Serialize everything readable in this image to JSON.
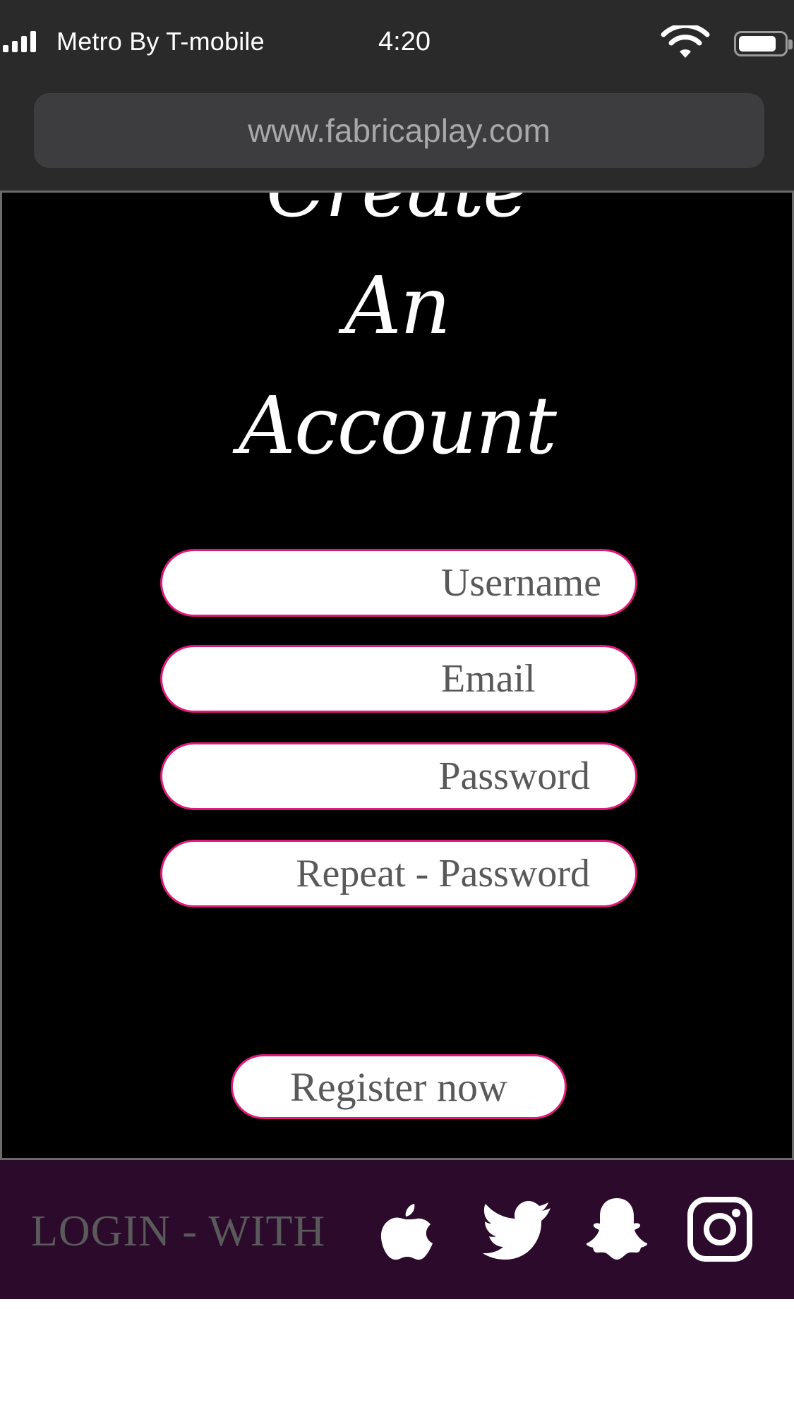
{
  "status_bar": {
    "carrier": "Metro By T-mobile",
    "time": "4:20"
  },
  "browser": {
    "url": "www.fabricaplay.com"
  },
  "page": {
    "title_lines": [
      "Create",
      "An",
      "Account"
    ],
    "fields": {
      "username_placeholder": "Username",
      "email_placeholder": "Email",
      "password_placeholder": "Password",
      "repeat_password_placeholder": "Repeat - Password"
    },
    "register_label": "Register now",
    "login_with_label": "LOGIN  - WITH",
    "social_icons": [
      "apple-icon",
      "twitter-icon",
      "snapchat-icon",
      "instagram-icon"
    ],
    "colors": {
      "accent": "#e01a7a",
      "footer_bg": "#2b0a2c",
      "page_bg": "#000000"
    }
  }
}
